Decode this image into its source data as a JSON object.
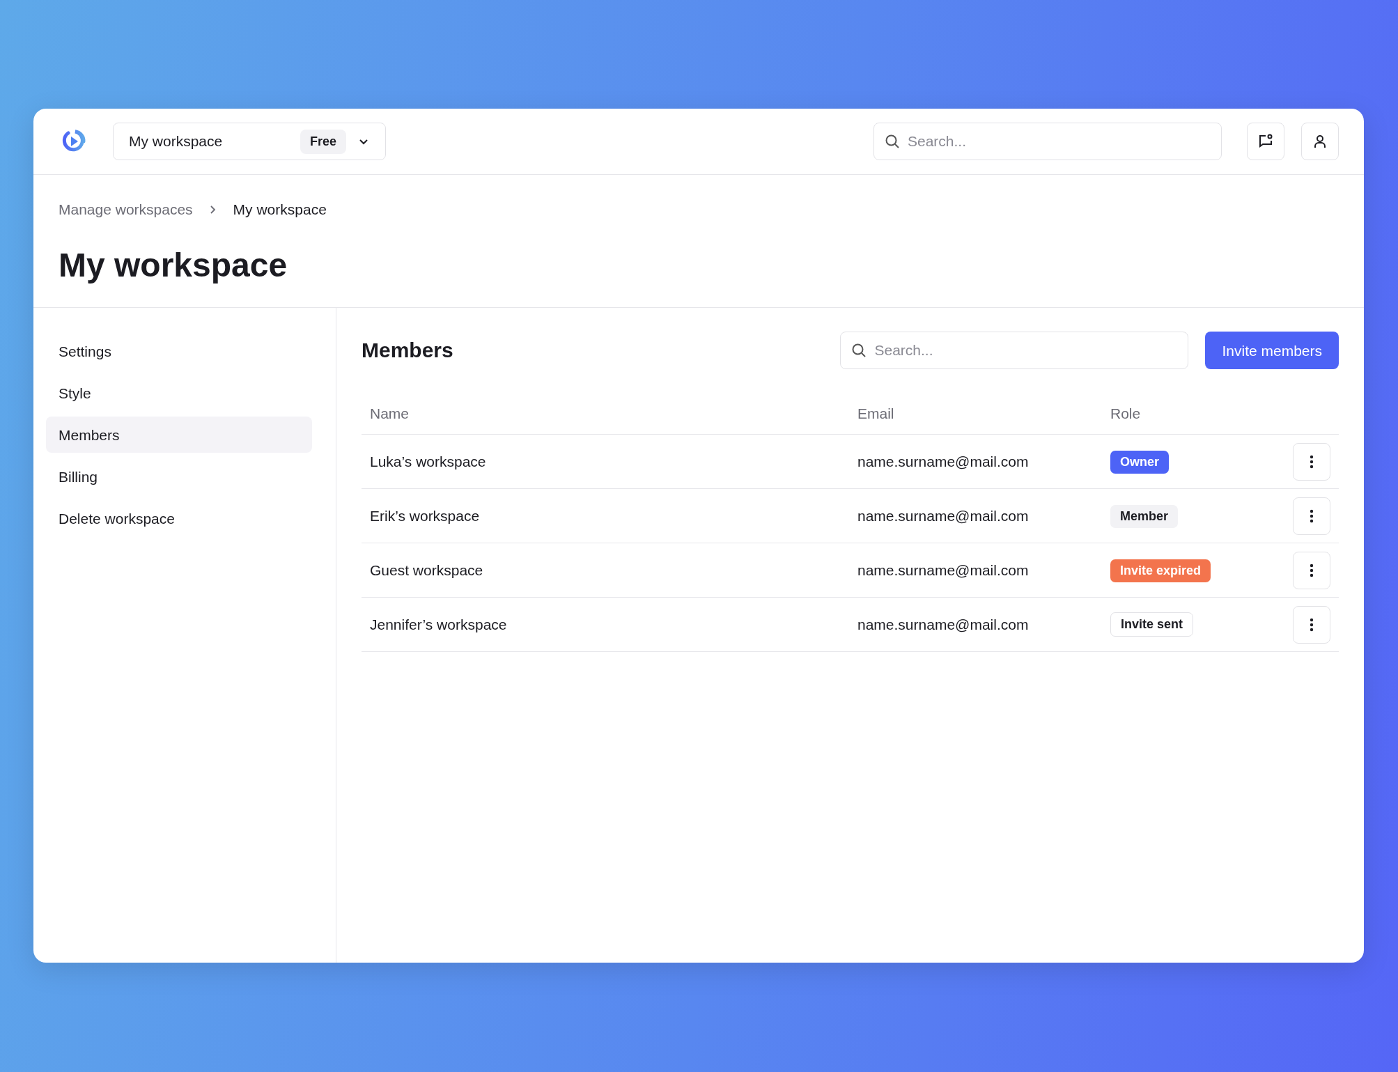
{
  "header": {
    "workspace": "My workspace",
    "plan": "Free",
    "search": {
      "placeholder": "Search..."
    }
  },
  "breadcrumb": [
    {
      "label": "Manage workspaces"
    },
    {
      "label": "My workspace"
    }
  ],
  "title": "My workspace",
  "sidebar": {
    "items": [
      {
        "label": "Settings",
        "selected": false
      },
      {
        "label": "Style",
        "selected": false
      },
      {
        "label": "Members",
        "selected": true
      },
      {
        "label": "Billing",
        "selected": false
      },
      {
        "label": "Delete workspace",
        "selected": false
      }
    ]
  },
  "members": {
    "heading": "Members",
    "search": {
      "placeholder": "Search..."
    },
    "invite_button": "Invite members",
    "table": {
      "columns": [
        "Name",
        "Email",
        "Role"
      ],
      "rows": [
        {
          "name": "Luka’s workspace",
          "email": "name.surname@mail.com",
          "role": {
            "label": "Owner",
            "kind": "owner"
          }
        },
        {
          "name": "Erik’s workspace",
          "email": "name.surname@mail.com",
          "role": {
            "label": "Member",
            "kind": "member"
          }
        },
        {
          "name": "Guest workspace",
          "email": "name.surname@mail.com",
          "role": {
            "label": "Invite expired",
            "kind": "expired"
          }
        },
        {
          "name": "Jennifer’s workspace",
          "email": "name.surname@mail.com",
          "role": {
            "label": "Invite sent",
            "kind": "sent"
          }
        }
      ]
    }
  }
}
